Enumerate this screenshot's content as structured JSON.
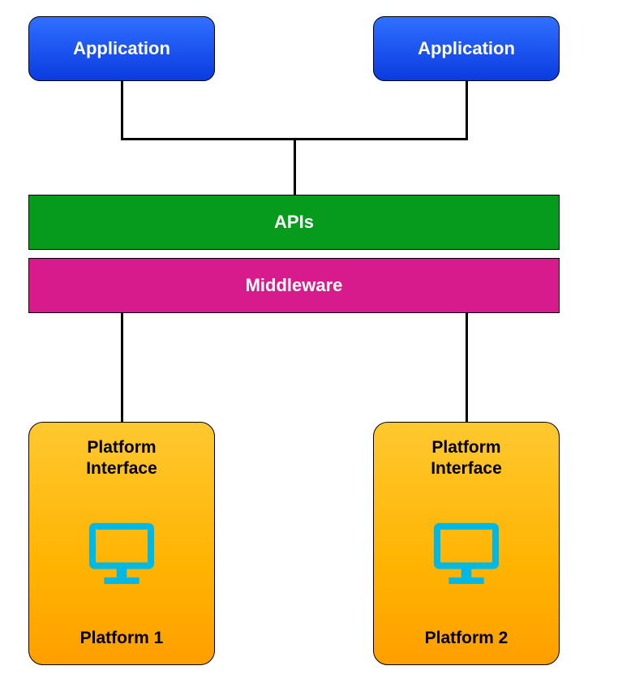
{
  "applications": {
    "left": {
      "label": "Application"
    },
    "right": {
      "label": "Application"
    }
  },
  "layers": {
    "apis": {
      "label": "APIs"
    },
    "middleware": {
      "label": "Middleware"
    }
  },
  "platforms": {
    "left": {
      "interface_label": "Platform Interface",
      "name": "Platform 1",
      "icon": "monitor-icon"
    },
    "right": {
      "interface_label": "Platform Interface",
      "name": "Platform 2",
      "icon": "monitor-icon"
    }
  },
  "colors": {
    "application": "#1a4df0",
    "apis": "#079b1e",
    "middleware": "#d81b8c",
    "platform": "#ffb300",
    "icon": "#00b8e6"
  }
}
